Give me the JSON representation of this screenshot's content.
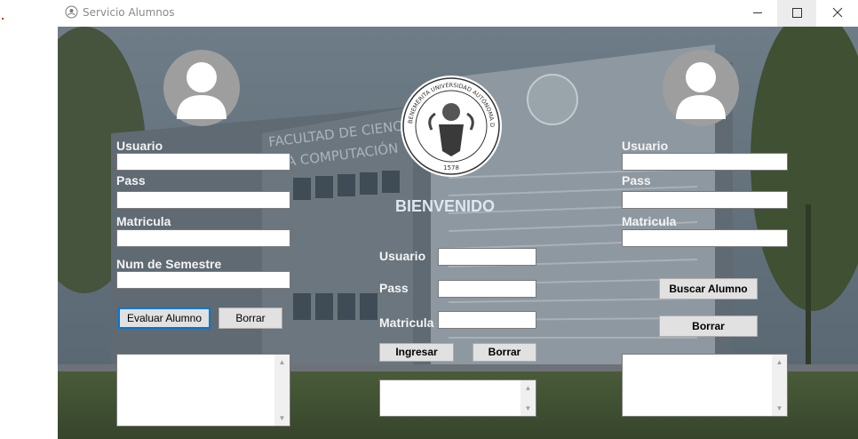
{
  "window": {
    "title": "Servicio Alumnos",
    "minimize": "—",
    "maximize": "☐",
    "close": "✕"
  },
  "welcome_text": "BIENVENIDO",
  "left_panel": {
    "usuario_label": "Usuario",
    "pass_label": "Pass",
    "matricula_label": "Matricula",
    "semestre_label": "Num de Semestre",
    "evaluar_button": "Evaluar Alumno",
    "borrar_button": "Borrar",
    "usuario_value": "",
    "pass_value": "",
    "matricula_value": "",
    "semestre_value": "",
    "output_value": ""
  },
  "center_panel": {
    "usuario_label": "Usuario",
    "pass_label": "Pass",
    "matricula_label": "Matricula",
    "ingresar_button": "Ingresar",
    "borrar_button": "Borrar",
    "usuario_value": "",
    "pass_value": "",
    "matricula_value": "",
    "output_value": ""
  },
  "right_panel": {
    "usuario_label": "Usuario",
    "pass_label": "Pass",
    "matricula_label": "Matricula",
    "buscar_button": "Buscar Alumno",
    "borrar_button": "Borrar",
    "usuario_value": "",
    "pass_value": "",
    "matricula_value": "",
    "output_value": ""
  },
  "seal": {
    "text": "BENEMÉRITA UNIVERSIDAD AUTÓNOMA DE PUEBLA",
    "year": "1578"
  },
  "background_sign": "FACULTAD DE CIENCIAS DE LA COMPUTACIÓN",
  "icons": [
    "app-icon",
    "user-avatar-icon",
    "university-seal-icon"
  ],
  "colors": {
    "label_text": "#f4f4f4",
    "focus_border": "#0078d7",
    "button_face": "#e1e1e1"
  }
}
